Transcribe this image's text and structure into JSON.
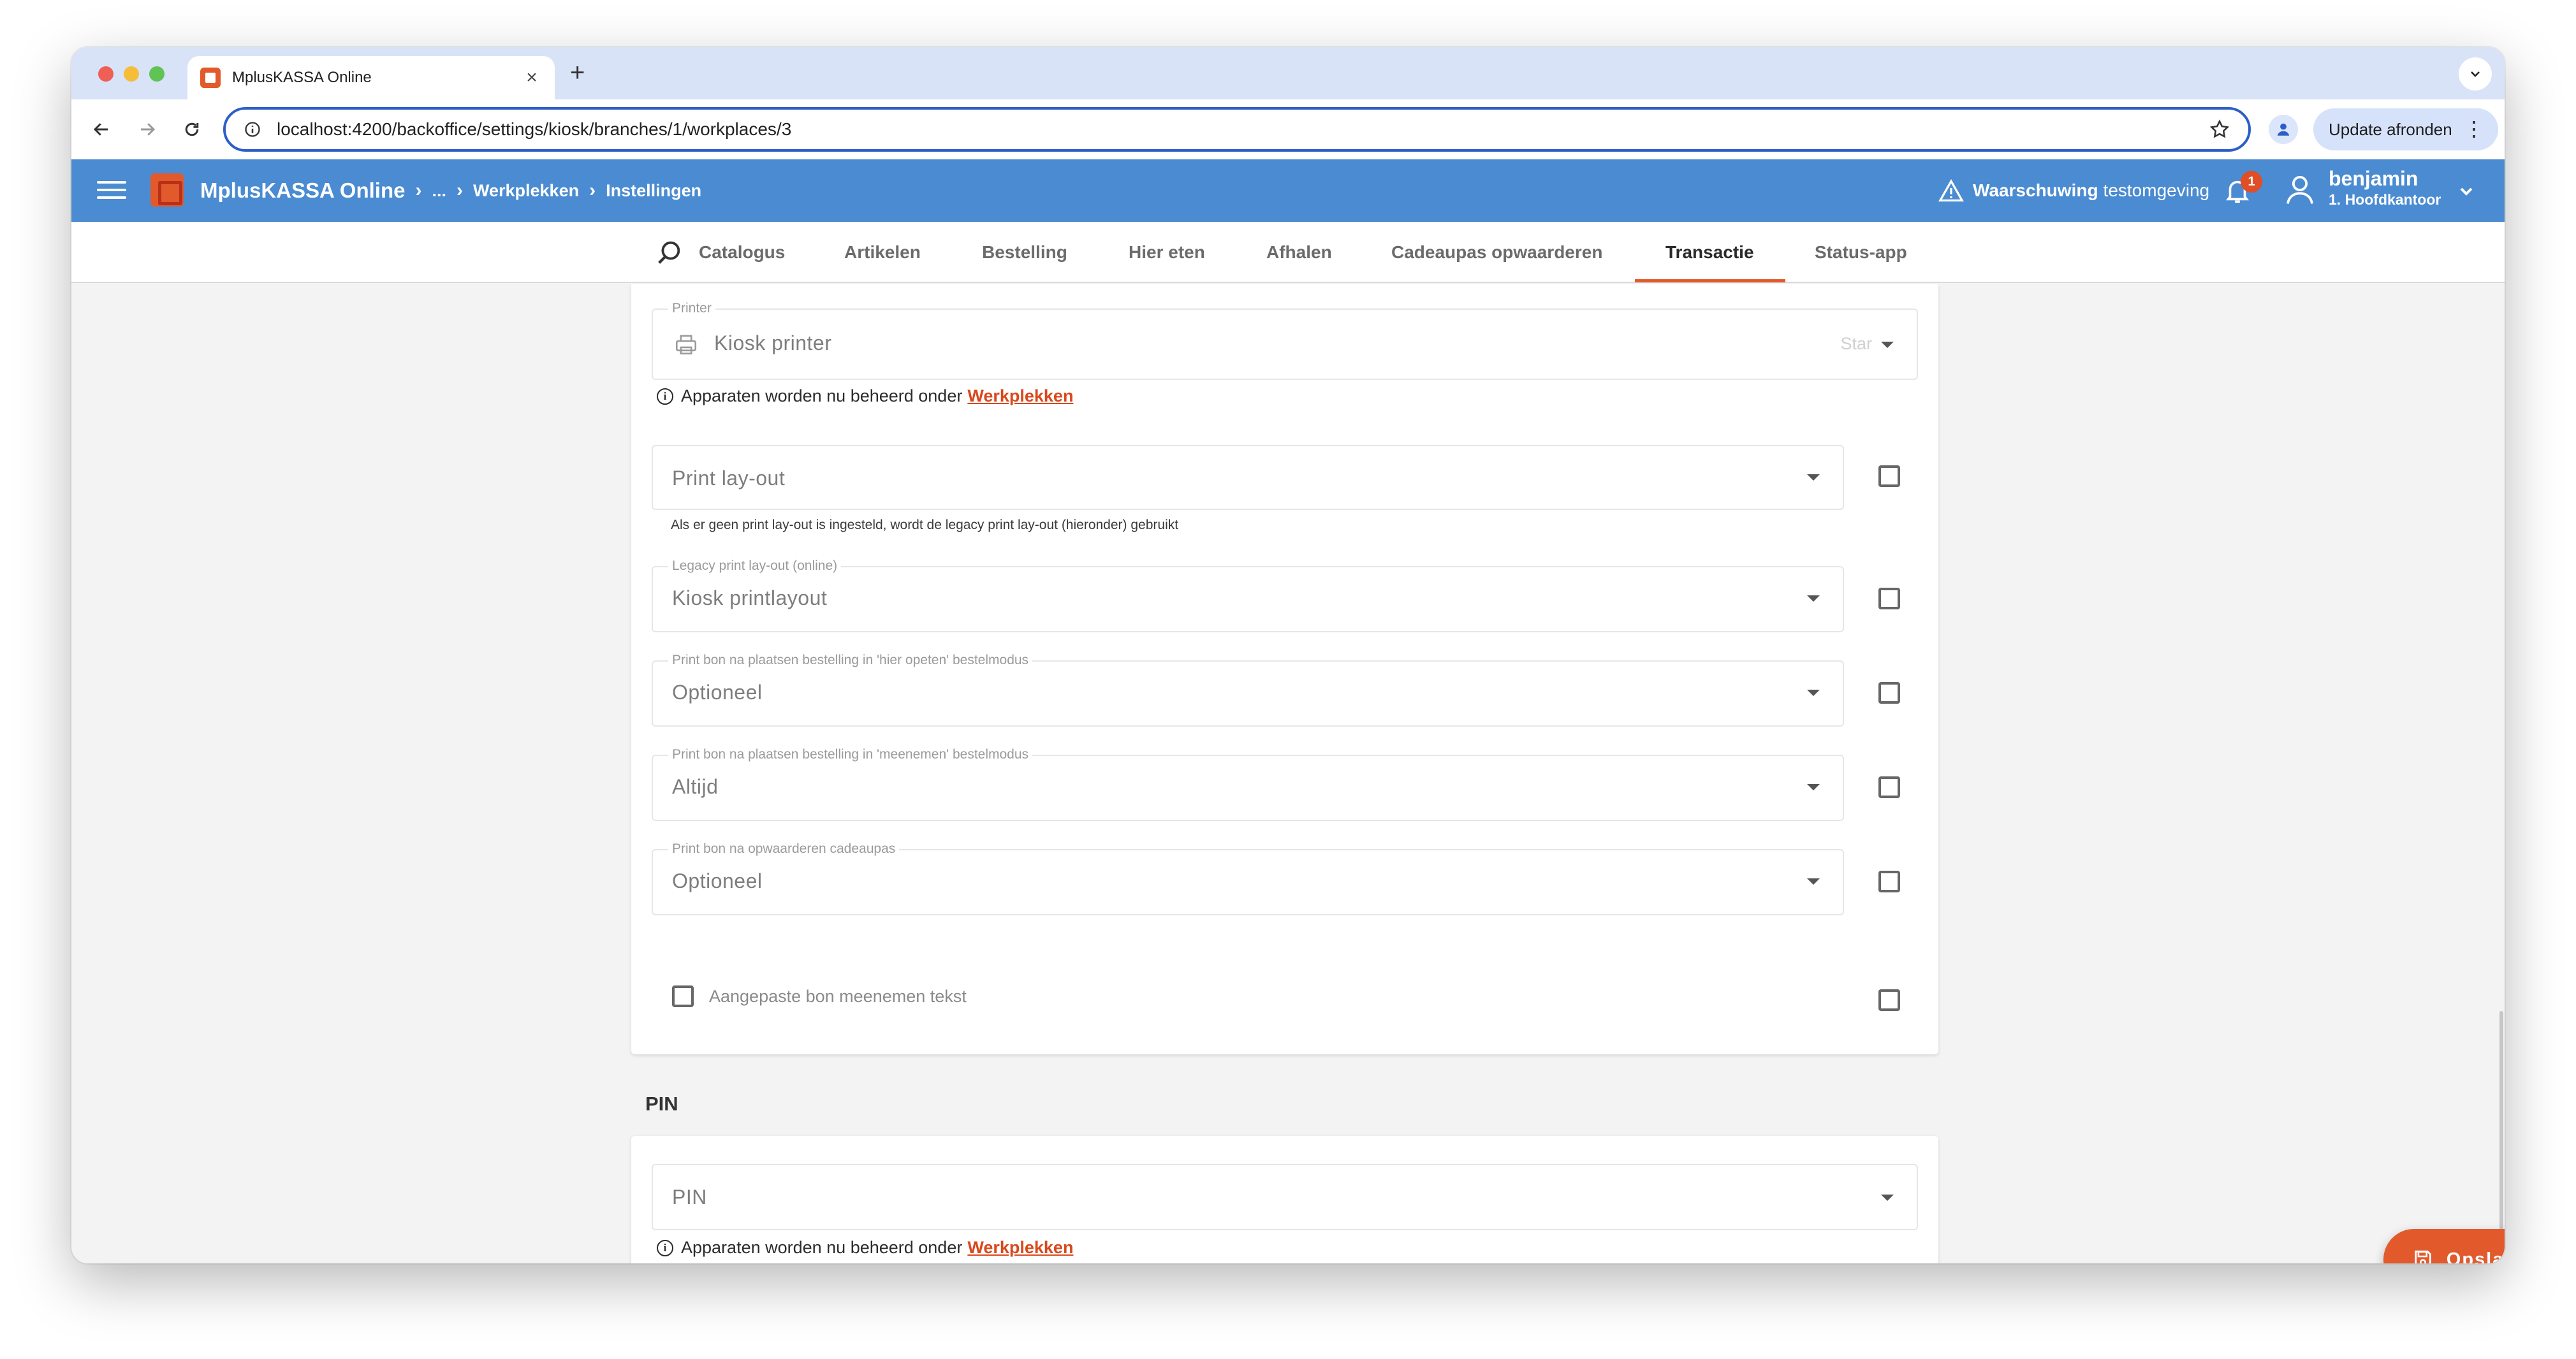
{
  "browser": {
    "tab_title": "MplusKASSA Online",
    "url": "localhost:4200/backoffice/settings/kiosk/branches/1/workplaces/3",
    "update_button": "Update afronden"
  },
  "header": {
    "app_name": "MplusKASSA Online",
    "breadcrumb_ellipsis": "...",
    "breadcrumbs": [
      "Werkplekken",
      "Instellingen"
    ],
    "warning_bold": "Waarschuwing",
    "warning_text": "testomgeving",
    "notification_count": "1",
    "user_name": "benjamin",
    "user_branch": "1. Hoofdkantoor"
  },
  "tabs": {
    "items": [
      "Catalogus",
      "Artikelen",
      "Bestelling",
      "Hier eten",
      "Afhalen",
      "Cadeaupas opwaarderen",
      "Transactie",
      "Status-app"
    ],
    "active": "Transactie"
  },
  "printer_card": {
    "printer_label": "Printer",
    "printer_value": "Kiosk printer",
    "printer_status": "Star",
    "devices_notice": "Apparaten worden nu beheerd onder",
    "devices_link": "Werkplekken",
    "print_layout_placeholder": "Print lay-out",
    "print_layout_hint": "Als er geen print lay-out is ingesteld, wordt de legacy print lay-out (hieronder) gebruikt",
    "legacy_label": "Legacy print lay-out (online)",
    "legacy_value": "Kiosk printlayout",
    "eat_in_label": "Print bon na plaatsen bestelling in 'hier opeten' bestelmodus",
    "eat_in_value": "Optioneel",
    "takeaway_label": "Print bon na plaatsen bestelling in 'meenemen' bestelmodus",
    "takeaway_value": "Altijd",
    "topup_label": "Print bon na opwaarderen cadeaupas",
    "topup_value": "Optioneel",
    "custom_text_label": "Aangepaste bon meenemen tekst"
  },
  "pin_section": {
    "title": "PIN",
    "pin_placeholder": "PIN",
    "devices_notice": "Apparaten worden nu beheerd onder",
    "devices_link": "Werkplekken"
  },
  "actions": {
    "save_label": "Opslaan"
  },
  "colors": {
    "brand_orange": "#e25a2c",
    "header_blue": "#4a8bd2",
    "link_orange": "#d9481c"
  }
}
